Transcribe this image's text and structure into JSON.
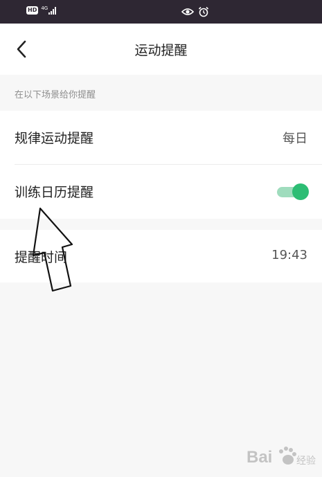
{
  "status_bar": {
    "hd_badge": "HD",
    "network_label": "4G",
    "signal_icon": "signal-bars-icon",
    "eye_icon": "eye-icon",
    "alarm_icon": "alarm-icon",
    "background_color": "#2e2733"
  },
  "header": {
    "back_icon": "chevron-left-icon",
    "title": "运动提醒"
  },
  "section": {
    "header": "在以下场景给你提醒"
  },
  "settings": [
    {
      "label": "规律运动提醒",
      "value": "每日"
    },
    {
      "label": "训练日历提醒",
      "toggle_on": true
    },
    {
      "label": "提醒时间",
      "value": "19:43"
    }
  ],
  "colors": {
    "toggle_on": "#2dbd74",
    "toggle_track": "#9fdcbd",
    "page_background": "#f7f7f7"
  },
  "annotation": {
    "type": "hand-drawn-arrow",
    "points_to": "训练日历提醒"
  },
  "watermark": {
    "logo": "baidu-paw-logo",
    "text": "Bai度经验"
  }
}
